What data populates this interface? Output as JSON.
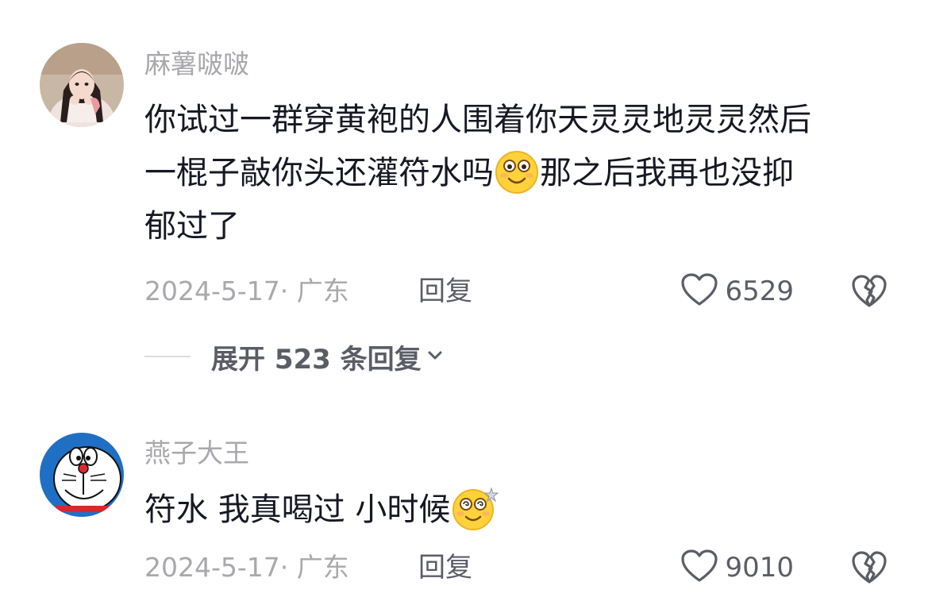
{
  "comments": [
    {
      "username": "麻薯啵啵",
      "avatar": "avatar-girl-photo",
      "lines": [
        {
          "before": "你试过一群穿黄袍的人围着你天灵灵地灵灵然后",
          "emoji": null,
          "after": ""
        },
        {
          "before": "一棍子敲你头还灌符水吗",
          "emoji": "smile-emoji",
          "after": "那之后我再也没抑"
        },
        {
          "before": "郁过了",
          "emoji": null,
          "after": ""
        }
      ],
      "date": "2024-5-17",
      "location": "· 广东",
      "reply_label": "回复",
      "likes": "6529",
      "expand": {
        "label": "展开 523 条回复"
      }
    },
    {
      "username": "燕子大王",
      "avatar": "avatar-doraemon",
      "lines": [
        {
          "before": "符水 我真喝过 小时候",
          "emoji": "dizzy-smile-emoji",
          "after": ""
        }
      ],
      "date": "2024-5-17",
      "location": "· 广东",
      "reply_label": "回复",
      "likes": "9010"
    }
  ],
  "icons": {
    "like": "heart-outline-icon",
    "dislike": "broken-heart-icon",
    "expand": "chevron-down-icon"
  },
  "colors": {
    "text": "#161823",
    "muted": "#a8a8ad",
    "secondary": "#5b5d66",
    "emoji_yellow": "#ffd23c"
  }
}
